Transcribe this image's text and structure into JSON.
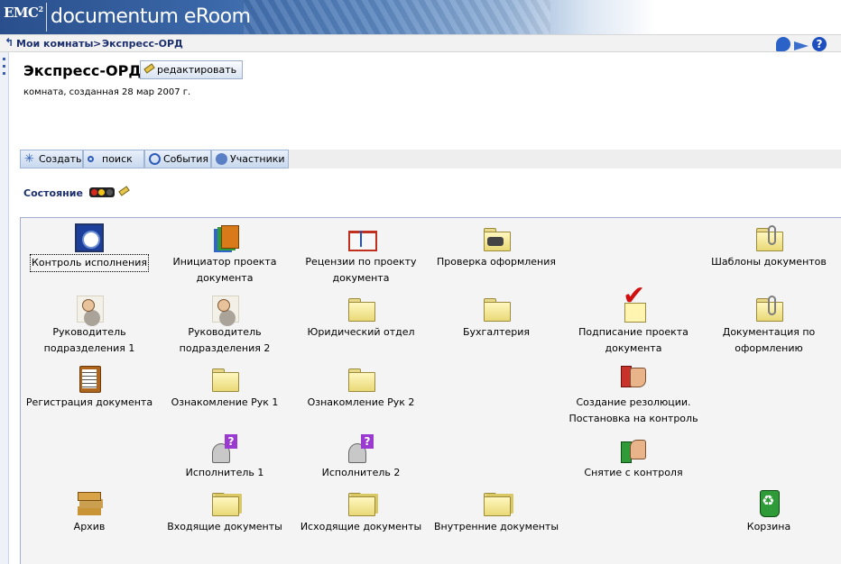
{
  "banner": {
    "brand": "EMC",
    "brand_sup": "2",
    "product": "documentum eRoom"
  },
  "breadcrumb": {
    "root": "Мои комнаты",
    "separator": ">",
    "current": "Экспресс-ОРД"
  },
  "room": {
    "title": "Экспресс-ОРД",
    "edit_label": "редактировать",
    "subtitle": "комната, созданная 28 мар 2007 г."
  },
  "commands": [
    {
      "label": "Создать",
      "icon": "create-icon"
    },
    {
      "label": "поиск",
      "icon": "search-icon"
    },
    {
      "label": "События",
      "icon": "events-icon"
    },
    {
      "label": "Участники",
      "icon": "members-icon"
    }
  ],
  "status": {
    "label": "Состояние",
    "light": "red-yellow"
  },
  "items": [
    {
      "label_lines": [
        "Контроль исполнения"
      ],
      "icon": "calendar-clock-icon",
      "selected": true
    },
    {
      "label_lines": [
        "Инициатор проекта",
        "документа"
      ],
      "icon": "files-icon"
    },
    {
      "label_lines": [
        "Рецензии по проекту",
        "документа"
      ],
      "icon": "notebook-icon"
    },
    {
      "label_lines": [
        "Проверка оформления"
      ],
      "icon": "folder-phone-icon"
    },
    {
      "label_lines": [
        "Шаблоны документов"
      ],
      "icon": "folder-clip-icon"
    },
    {
      "label_lines": [
        "Руководитель",
        "подразделения 1"
      ],
      "icon": "person-icon"
    },
    {
      "label_lines": [
        "Руководитель",
        "подразделения 2"
      ],
      "icon": "person-icon"
    },
    {
      "label_lines": [
        "Юридический отдел"
      ],
      "icon": "folder-icon"
    },
    {
      "label_lines": [
        "Бухгалтерия"
      ],
      "icon": "folder-icon"
    },
    {
      "label_lines": [
        "Подписание проекта",
        "документа"
      ],
      "icon": "checkmark-icon"
    },
    {
      "label_lines": [
        "Документация по",
        "оформлению"
      ],
      "icon": "folder-clip-icon"
    },
    {
      "label_lines": [
        "Регистрация документа"
      ],
      "icon": "clipboard-icon"
    },
    {
      "label_lines": [
        "Ознакомление Рук 1"
      ],
      "icon": "folder-icon"
    },
    {
      "label_lines": [
        "Ознакомление Рук 2"
      ],
      "icon": "folder-icon"
    },
    {
      "label_lines": [
        "Создание резолюции.",
        "Постановка на контроль"
      ],
      "icon": "thumbs-down-icon"
    },
    {
      "label_lines": [
        "Исполнитель 1"
      ],
      "icon": "user-question-icon"
    },
    {
      "label_lines": [
        "Исполнитель 2"
      ],
      "icon": "user-question-icon"
    },
    {
      "label_lines": [
        "Снятие с контроля"
      ],
      "icon": "thumbs-up-icon"
    },
    {
      "label_lines": [
        "Архив"
      ],
      "icon": "archive-icon"
    },
    {
      "label_lines": [
        "Входящие документы"
      ],
      "icon": "folder-stack-icon"
    },
    {
      "label_lines": [
        "Исходящие документы"
      ],
      "icon": "folder-stack-icon"
    },
    {
      "label_lines": [
        "Внутренние документы"
      ],
      "icon": "folder-stack-icon"
    },
    {
      "label_lines": [
        "Корзина"
      ],
      "icon": "recycle-bin-icon"
    }
  ]
}
